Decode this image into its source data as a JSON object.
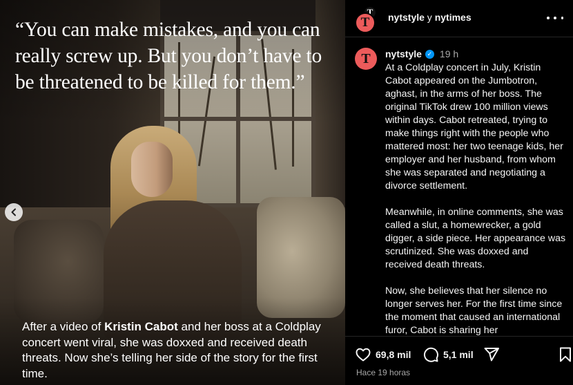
{
  "media": {
    "quote": "“You can make mistakes, and you can really screw up. But you don’t have to be threatened to be killed for them.”",
    "caption_before": "After a video of ",
    "caption_bold": "Kristin Cabot",
    "caption_after": " and her boss at a Coldplay concert went viral, she was doxxed and received death threats. Now she’s telling her side of the story for the first time.",
    "prev_icon": "chevron-left-icon"
  },
  "header": {
    "account": "nytstyle",
    "connector": " y ",
    "collaborator": "nytimes",
    "avatar_glyph": "T",
    "more_icon": "more-horizontal-icon"
  },
  "post": {
    "username": "nytstyle",
    "verified_glyph": "✓",
    "time": "19 h",
    "paragraphs": [
      "At a Coldplay concert in July, Kristin Cabot appeared on the Jumbotron, aghast, in the arms of her boss. The original TikTok drew 100 million views within days. Cabot retreated, trying to make things right with the people who mattered most: her two teenage kids, her employer and her husband, from whom she was separated and negotiating a divorce settlement.",
      "Meanwhile, in online comments, she was called a slut, a homewrecker, a gold digger, a side piece. Her appearance was scrutinized. She was doxxed and received death threats.",
      "Now, she believes that her silence no longer serves her. For the first time since the moment that caused an international furor, Cabot is sharing her"
    ]
  },
  "actions": {
    "likes": "69,8 mil",
    "comments": "5,1 mil",
    "posted": "Hace 19 horas",
    "icons": [
      "heart-icon",
      "comment-icon",
      "share-icon",
      "bookmark-icon"
    ]
  },
  "colors": {
    "background": "#000000",
    "nyt_badge": "#ec5b5b",
    "verified": "#0095f6",
    "muted_text": "#a8a8a8"
  }
}
